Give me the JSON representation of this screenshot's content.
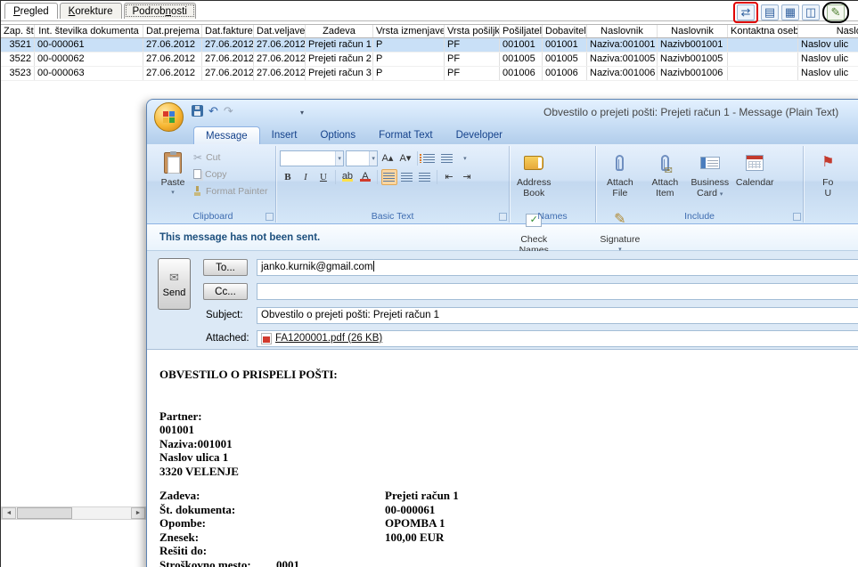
{
  "app": {
    "tabs": [
      {
        "pre": "",
        "key": "P",
        "post": "regled"
      },
      {
        "pre": "",
        "key": "K",
        "post": "orekture"
      },
      {
        "pre": "Podrob",
        "key": "n",
        "post": "osti"
      }
    ],
    "grid": {
      "headers": [
        "Zap. št.",
        "Int. številka dokumenta",
        "Dat.prejema",
        "Dat.fakture",
        "Dat.veljave",
        "Zadeva",
        "Vrsta izmenjave",
        "Vrsta pošiljke",
        "Pošiljatelj",
        "Dobavitelj",
        "Naslovnik",
        "Naslovnik",
        "Kontaktna oseba",
        "Naslov"
      ],
      "rows": [
        [
          "3521",
          "00-000061",
          "27.06.2012",
          "27.06.2012",
          "27.06.2012",
          "Prejeti račun 1",
          "P",
          "PF",
          "001001",
          "001001",
          "Naziva:001001",
          "Nazivb001001",
          "",
          "Naslov ulic"
        ],
        [
          "3522",
          "00-000062",
          "27.06.2012",
          "27.06.2012",
          "27.06.2012",
          "Prejeti račun 2",
          "P",
          "PF",
          "001005",
          "001005",
          "Naziva:001005",
          "Nazivb001005",
          "",
          "Naslov ulic"
        ],
        [
          "3523",
          "00-000063",
          "27.06.2012",
          "27.06.2012",
          "27.06.2012",
          "Prejeti račun 3",
          "P",
          "PF",
          "001006",
          "001006",
          "Naziva:001006",
          "Nazivb001006",
          "",
          "Naslov ulic"
        ]
      ]
    }
  },
  "icons": {
    "send_receive": "⇄",
    "export_table": "▤",
    "export_grid": "▦",
    "export_window": "◫",
    "edit_pencil": "✎",
    "undo": "↶",
    "redo": "↷",
    "qat_dropdown": "▾",
    "dropdown": "▾",
    "scissors": "✂",
    "check": "✓",
    "flag": "⚑",
    "pen": "✎",
    "envelope": "✉",
    "bold": "B",
    "italic": "I",
    "underline": "U",
    "grow_font": "A▴",
    "shrink_font": "A▾",
    "indent_dec": "⇤",
    "indent_inc": "⇥",
    "highlight": "ab",
    "font_color": "A",
    "scroll_left": "◄",
    "scroll_right": "►",
    "send_envelope": "✉"
  },
  "outlook": {
    "title": "Obvestilo o prejeti pošti: Prejeti račun 1 - Message (Plain Text)",
    "tabs": [
      "Message",
      "Insert",
      "Options",
      "Format Text",
      "Developer"
    ],
    "clipboard": {
      "paste": "Paste",
      "cut": "Cut",
      "copy": "Copy",
      "painter": "Format Painter",
      "label": "Clipboard"
    },
    "basic_text": {
      "label": "Basic Text"
    },
    "names": {
      "address1": "Address",
      "address2": "Book",
      "check1": "Check",
      "check2": "Names",
      "label": "Names"
    },
    "include": {
      "attach_file1": "Attach",
      "attach_file2": "File",
      "attach_item1": "Attach",
      "attach_item2": "Item",
      "card1": "Business",
      "card2": "Card",
      "calendar": "Calendar",
      "signature": "Signature",
      "label": "Include"
    },
    "followup": {
      "l1": "Fo",
      "l2": "U"
    },
    "infobar": "This message has not been sent.",
    "form": {
      "send": "Send",
      "to_btn": "To...",
      "to_value": "janko.kurnik@gmail.com",
      "cc_btn": "Cc...",
      "cc_value": "",
      "subject_label": "Subject:",
      "subject_value": "Obvestilo o prejeti pošti: Prejeti račun 1",
      "attached_label": "Attached:",
      "attachment": "FA1200001.pdf (26 KB)"
    },
    "body": {
      "heading": "OBVESTILO O PRISPELI POŠTI:",
      "p1": "Partner:",
      "p2": "001001",
      "p3": "Naziva:001001",
      "p4": "Naslov ulica 1",
      "p5": "3320 VELENJE",
      "d": [
        {
          "l": "Zadeva:",
          "v": "Prejeti račun 1"
        },
        {
          "l": "Št. dokumenta:",
          "v": "00-000061"
        },
        {
          "l": "Opombe:",
          "v": "OPOMBA 1"
        },
        {
          "l": "Znesek:",
          "v": "100,00 EUR"
        },
        {
          "l": "Rešiti do:",
          "v": ""
        },
        {
          "l": "Stroškovno mesto:",
          "v": "0001"
        }
      ]
    }
  }
}
